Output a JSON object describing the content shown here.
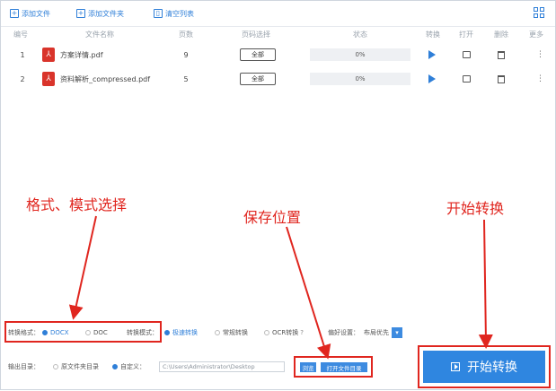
{
  "toolbar": {
    "add_file": "添加文件",
    "add_folder": "添加文件夹",
    "clear_list": "清空列表"
  },
  "table": {
    "headers": [
      "编号",
      "文件名称",
      "页数",
      "页码选择",
      "状态",
      "转换",
      "打开",
      "删除",
      "更多"
    ],
    "rows": [
      {
        "index": "1",
        "name": "方案详情.pdf",
        "pages": "9",
        "range": "全部",
        "progress": "0%"
      },
      {
        "index": "2",
        "name": "资料解析_compressed.pdf",
        "pages": "5",
        "range": "全部",
        "progress": "0%"
      }
    ]
  },
  "annotations": {
    "format_mode": "格式、模式选择",
    "save_location": "保存位置",
    "start_convert": "开始转换"
  },
  "options": {
    "format_label": "转换格式：",
    "format_docx": "DOCX",
    "format_doc": "DOC",
    "mode_label": "转换模式：",
    "mode_fast": "极速转换",
    "mode_normal": "常规转换",
    "mode_ocr": "OCR转换",
    "preference_label": "偏好设置：",
    "preference_value": "布局优先"
  },
  "output": {
    "label": "输出目录：",
    "original_dir": "原文件夹目录",
    "custom": "自定义：",
    "path": "C:\\Users\\Administrator\\Desktop",
    "browse": "浏览",
    "open_folder": "打开文件目录"
  },
  "start_button": "开始转换",
  "colors": {
    "accent": "#2f86e0",
    "annotation": "#e0261f",
    "pdf": "#d9342b"
  }
}
